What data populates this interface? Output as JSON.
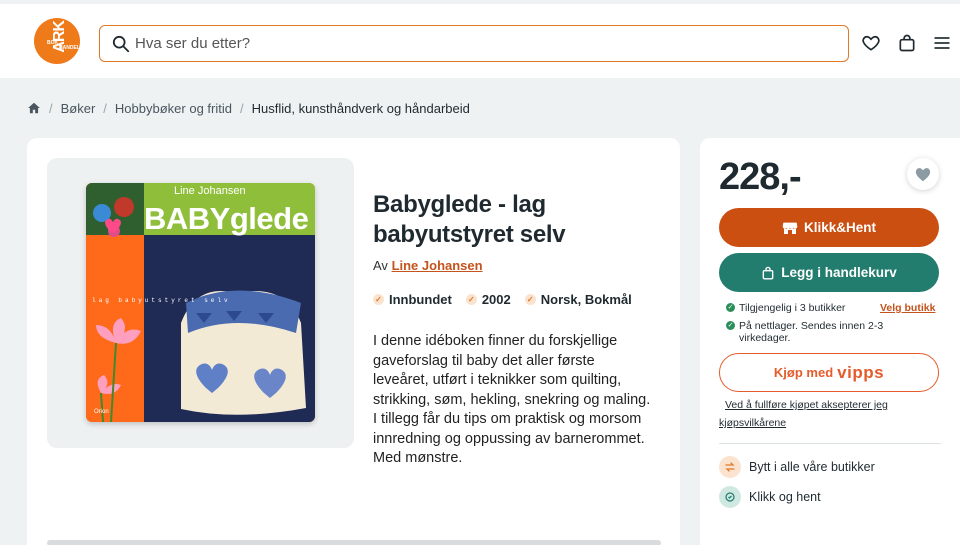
{
  "header": {
    "logo_big": "ARK",
    "logo_small_1": "BOK",
    "logo_small_2": "HANDEL",
    "search_placeholder": "Hva ser du etter?",
    "icons": [
      "search-icon",
      "heart-icon",
      "bag-icon",
      "menu-icon"
    ],
    "accent_color": "#e07a2a"
  },
  "breadcrumb": {
    "home_icon": "home-icon",
    "items": [
      "Bøker",
      "Hobbybøker og fritid",
      "Husflid, kunsthåndverk og håndarbeid"
    ],
    "separator": "/"
  },
  "product": {
    "title": "Babyglede - lag babyutstyret selv",
    "by_prefix": "Av",
    "author": "Line Johansen",
    "facts": [
      "Innbundet",
      "2002",
      "Norsk, Bokmål"
    ],
    "description": "I denne idéboken finner du forskjellige gaveforslag til baby det aller første leveåret, utført i teknikker som quilting, strikking, søm, hekling, snekring og maling. I tillegg får du tips om praktisk og morsom innredning og oppussing av barnerommet. Med mønstre.",
    "cover": {
      "author_text": "Line Johansen",
      "title_text": "BABYglede",
      "subtitle_text": "lag babyutstyret selv",
      "publisher_text": "Orion"
    }
  },
  "buybox": {
    "price": "228,-",
    "click_collect_label": "Klikk&Hent",
    "add_to_cart_label": "Legg i handlekurv",
    "availability_store": "Tilgjengelig i 3 butikker",
    "choose_store_link": "Velg butikk",
    "availability_online": "På nettlager. Sendes innen 2-3 virkedager.",
    "vipps_prefix": "Kjøp med",
    "vipps_brand": "vipps",
    "terms_line1": "Ved å fullføre kjøpet aksepterer jeg",
    "terms_line2": "kjøpsvilkårene",
    "perks": [
      "Bytt i alle våre butikker",
      "Klikk og hent"
    ],
    "colors": {
      "orange": "#cc4f12",
      "green": "#237d6e",
      "vipps": "#e55b2c"
    }
  }
}
